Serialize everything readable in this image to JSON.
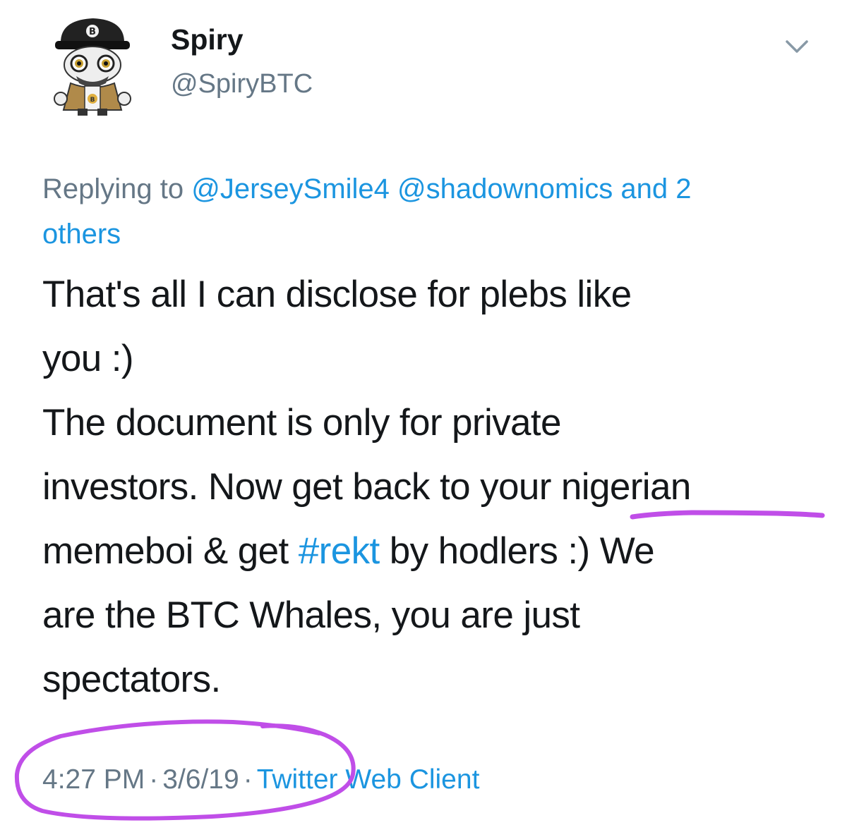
{
  "tweet": {
    "author": {
      "display_name": "Spiry",
      "handle": "@SpiryBTC",
      "avatar_icon": "bitcoin-mascot-avatar-icon"
    },
    "menu_icon": "chevron-down-icon",
    "reply": {
      "prefix": "Replying to ",
      "mentions": [
        "@JerseySmile4",
        "@shadownomics"
      ],
      "and_others": "and 2",
      "others_word": "others"
    },
    "text_lines": {
      "l1": "That's all I can disclose for plebs like",
      "l2": "you :)",
      "l3": "The document is only for private",
      "l4a": "investors. Now get back to your ",
      "l4b": "nigerian",
      "l5a": "memeboi & get ",
      "hashtag": "#rekt",
      "l5b": " by hodlers :) We",
      "l6": "are the BTC Whales, you are just",
      "l7": "spectators."
    },
    "meta": {
      "time": "4:27 PM",
      "date": "3/6/19",
      "separator": "·",
      "source": "Twitter Web Client"
    }
  },
  "colors": {
    "text": "#14171a",
    "secondary": "#657786",
    "link": "#1b95e0",
    "annotation": "#c04ee8"
  }
}
